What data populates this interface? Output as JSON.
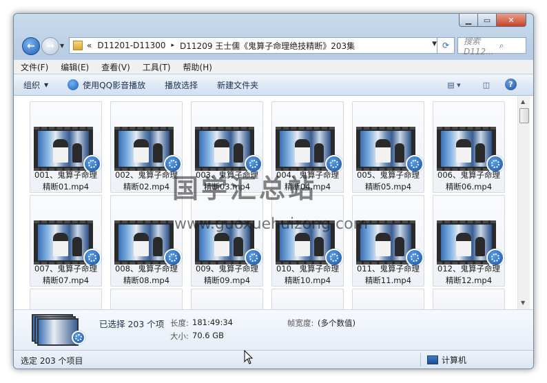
{
  "address": {
    "parts": [
      "D11201-D11300",
      "D11209 王士儒《鬼算子命理绝技精断》203集"
    ],
    "history_marker": "«",
    "separator": "▸"
  },
  "search": {
    "placeholder": "搜索 D112..."
  },
  "menu": [
    "文件(F)",
    "编辑(E)",
    "查看(V)",
    "工具(T)",
    "帮助(H)"
  ],
  "toolbar": {
    "organize": "组织",
    "play_qq": "使用QQ影音播放",
    "burn": "播放选择",
    "new_folder": "新建文件夹"
  },
  "files": [
    {
      "line1": "001、鬼算子命理",
      "line2": "精断01.mp4"
    },
    {
      "line1": "002、鬼算子命理",
      "line2": "精断02.mp4"
    },
    {
      "line1": "003、鬼算子命理",
      "line2": "精断03.mp4"
    },
    {
      "line1": "004、鬼算子命理",
      "line2": "精断04.mp4"
    },
    {
      "line1": "005、鬼算子命理",
      "line2": "精断05.mp4"
    },
    {
      "line1": "006、鬼算子命理",
      "line2": "精断06.mp4"
    },
    {
      "line1": "007、鬼算子命理",
      "line2": "精断07.mp4"
    },
    {
      "line1": "008、鬼算子命理",
      "line2": "精断08.mp4"
    },
    {
      "line1": "009、鬼算子命理",
      "line2": "精断09.mp4"
    },
    {
      "line1": "010、鬼算子命理",
      "line2": "精断10.mp4"
    },
    {
      "line1": "011、鬼算子命理",
      "line2": "精断11.mp4"
    },
    {
      "line1": "012、鬼算子命理",
      "line2": "精断12.mp4"
    }
  ],
  "watermark": {
    "title": "国学汇总站",
    "url": "www.guoxuehuizong.com"
  },
  "details": {
    "selected": "已选择 203 个项",
    "length_label": "长度:",
    "length_value": "181:49:34",
    "size_label": "大小:",
    "size_value": "70.6 GB",
    "framewidth_label": "帧宽度:",
    "framewidth_value": "(多个数值)"
  },
  "status": {
    "text": "选定 203 个项目",
    "location": "计算机"
  }
}
